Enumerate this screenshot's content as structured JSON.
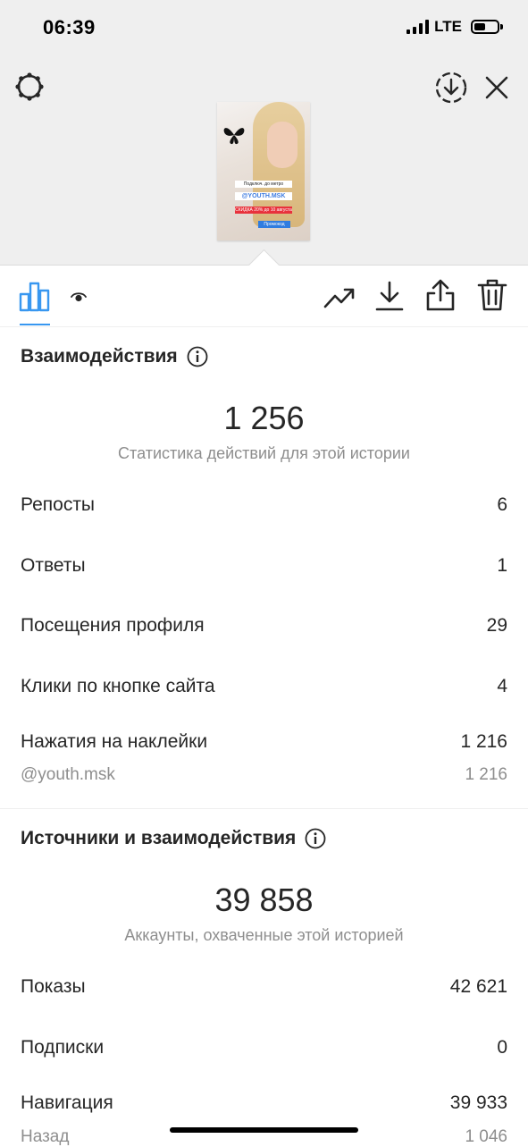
{
  "status_bar": {
    "time": "06:39",
    "network": "LTE"
  },
  "story_preview": {
    "sticker_top": "Подключ. до метро",
    "sticker_handle": "@YOUTH.MSK",
    "sticker_discount": "СКИДКА 20% до 10 августа",
    "sticker_small": "Промокод"
  },
  "interactions": {
    "title": "Взаимодействия",
    "total": "1 256",
    "caption": "Статистика действий для этой истории",
    "rows": [
      {
        "label": "Репосты",
        "value": "6"
      },
      {
        "label": "Ответы",
        "value": "1"
      },
      {
        "label": "Посещения профиля",
        "value": "29"
      },
      {
        "label": "Клики по кнопке сайта",
        "value": "4"
      },
      {
        "label": "Нажатия на наклейки",
        "value": "1 216"
      }
    ],
    "sub_row": {
      "label": "@youth.msk",
      "value": "1 216"
    }
  },
  "discovery": {
    "title": "Источники и взаимодействия",
    "total": "39 858",
    "caption": "Аккаунты, охваченные этой историей",
    "rows": [
      {
        "label": "Показы",
        "value": "42 621"
      },
      {
        "label": "Подписки",
        "value": "0"
      },
      {
        "label": "Навигация",
        "value": "39 933"
      }
    ],
    "sub_row": {
      "label": "Назад",
      "value": "1 046"
    }
  },
  "colors": {
    "accent": "#3897f0",
    "muted": "#8e8e8e",
    "text": "#262626",
    "header_bg": "#efefef"
  }
}
